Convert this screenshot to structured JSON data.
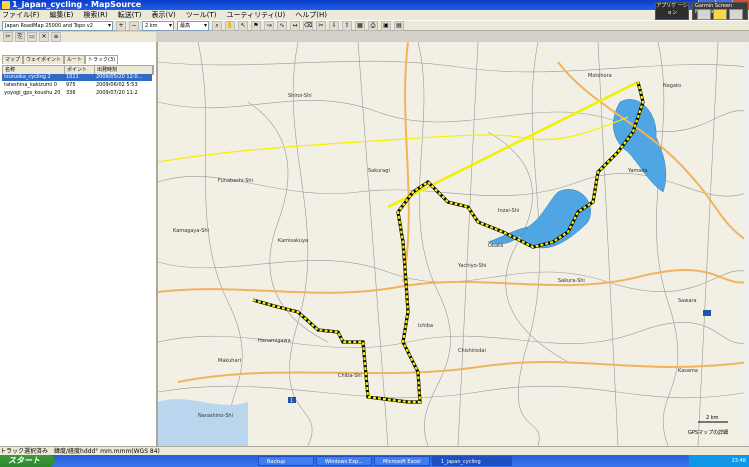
{
  "window": {
    "title": "1_japan_cycling - MapSource",
    "buttons": {
      "minimize": "_",
      "maximize": "□",
      "close": "×"
    }
  },
  "menu": [
    "ファイル(F)",
    "編集(E)",
    "検索(R)",
    "転送(T)",
    "表示(V)",
    "ツール(T)",
    "ユーティリティ(U)",
    "ヘルプ(H)"
  ],
  "toolbar": {
    "map_product": "Japan RoadMap 25000 and Topo v2",
    "scale": "2 km",
    "detail": "最高"
  },
  "gps": {
    "box1": "アプリケ\nーション",
    "manager": "Garmin Screen Manager"
  },
  "panel": {
    "tabs": [
      "マップ",
      "ウェイポイント",
      "ルート",
      "トラック(3)"
    ],
    "active_tab": 3,
    "columns": [
      "名称",
      "ポイント",
      "出発時刻"
    ],
    "rows": [
      {
        "name": "tsuruoka_cycling 2",
        "points": "1011",
        "start": "2009/05/20 12:0…",
        "selected": true
      },
      {
        "name": "tateshina_kakizumi 0",
        "points": "975",
        "start": "2009/06/02 5:53"
      },
      {
        "name": "yoyogi_gps_koushu 20",
        "points": "336",
        "start": "2009/07/20 11:2"
      }
    ]
  },
  "map": {
    "labels": [
      "Shiroi-Shi",
      "Funabashi-Shi",
      "Kamagaya-Shi",
      "Yachiyo-Shi",
      "Sakura-Shi",
      "Chiba-Shi",
      "Narashino-Shi",
      "Inzai-Shi",
      "Motohora",
      "Nagato",
      "Yamada",
      "Kamisakuya",
      "Obata",
      "Sakuragi",
      "Ichiba",
      "Hanamigawa",
      "Chishirodai",
      "Sawara",
      "Makuhari",
      "Kasama"
    ],
    "scale_text": "2 km",
    "detail_text": "GPSマップの詳細",
    "route_number": "1",
    "track_color": "#f4f000",
    "water_color": "#4fa6e3",
    "road_color": "#f0b45a"
  },
  "status": {
    "text": "トラック選択済み　緯度/経度hddd°  mm.mmm(WGS 84)"
  },
  "taskbar": {
    "start": "スタート",
    "tasks": [
      "Backup",
      "Windows Exp...",
      "Microsoft Excel",
      "1_japan_cycling"
    ],
    "active_task": 3,
    "time": "23:48"
  }
}
